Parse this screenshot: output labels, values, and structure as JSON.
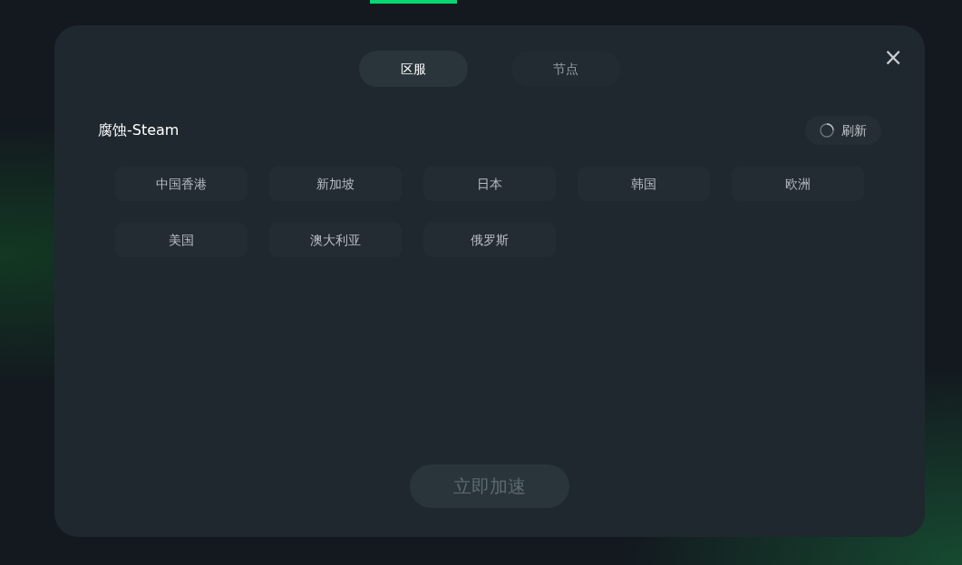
{
  "tabs": [
    {
      "label": "区服",
      "selected": true
    },
    {
      "label": "节点",
      "selected": false
    }
  ],
  "close": {
    "label": "×"
  },
  "game_title": "腐蚀-Steam",
  "refresh": {
    "label": "刷新"
  },
  "regions": [
    {
      "label": "中国香港",
      "selected": false
    },
    {
      "label": "新加坡",
      "selected": false
    },
    {
      "label": "日本",
      "selected": false
    },
    {
      "label": "韩国",
      "selected": false
    },
    {
      "label": "欧洲",
      "selected": false
    },
    {
      "label": "美国",
      "selected": false
    },
    {
      "label": "澳大利亚",
      "selected": false
    },
    {
      "label": "俄罗斯",
      "selected": false
    }
  ],
  "start_button": {
    "label": "立即加速",
    "disabled": true
  }
}
